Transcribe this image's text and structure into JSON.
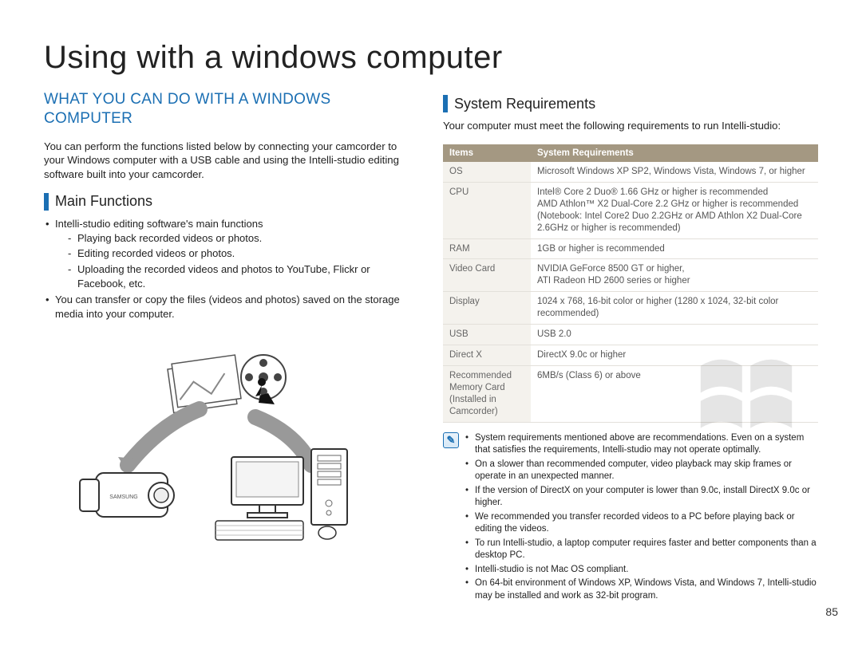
{
  "page": {
    "title": "Using with a windows computer",
    "number": "85"
  },
  "left": {
    "heading": "WHAT YOU CAN DO WITH A WINDOWS COMPUTER",
    "intro": "You can perform the functions listed below by connecting your camcorder to your Windows computer with a USB cable and using the Intelli-studio editing software built into your camcorder.",
    "mainFunctionsLabel": "Main Functions",
    "bullet1": "Intelli-studio editing software's main functions",
    "dash1": "Playing back recorded videos or photos.",
    "dash2": "Editing recorded videos or photos.",
    "dash3": "Uploading the recorded videos and photos to YouTube, Flickr or Facebook, etc.",
    "bullet2": "You can transfer or copy the files (videos and photos) saved on the storage media into your computer."
  },
  "right": {
    "sysReqLabel": "System Requirements",
    "intro": "Your computer must meet the following requirements to run Intelli-studio:",
    "tableHeaders": {
      "items": "Items",
      "req": "System Requirements"
    },
    "rows": [
      {
        "item": "OS",
        "req": "Microsoft Windows XP SP2, Windows Vista, Windows 7, or higher"
      },
      {
        "item": "CPU",
        "req": "Intel® Core 2 Duo® 1.66 GHz or higher is recommended\nAMD Athlon™ X2 Dual-Core 2.2 GHz or higher is recommended\n(Notebook: Intel Core2 Duo 2.2GHz or AMD Athlon X2 Dual-Core 2.6GHz or higher is recommended)"
      },
      {
        "item": "RAM",
        "req": "1GB or higher is recommended"
      },
      {
        "item": "Video Card",
        "req": "NVIDIA GeForce 8500 GT or higher,\nATI Radeon HD 2600 series or higher"
      },
      {
        "item": "Display",
        "req": "1024 x 768, 16-bit color or higher (1280 x 1024, 32-bit color recommended)"
      },
      {
        "item": "USB",
        "req": "USB 2.0"
      },
      {
        "item": "Direct X",
        "req": "DirectX 9.0c or higher"
      },
      {
        "item": "Recommended Memory Card (Installed in Camcorder)",
        "req": "6MB/s (Class 6) or above"
      }
    ],
    "notes": [
      "System requirements mentioned above are recommendations. Even on a system that satisfies the requirements, Intelli-studio may not operate optimally.",
      "On a slower than recommended computer, video playback may skip frames or operate in an unexpected manner.",
      "If the version of DirectX on your computer is lower than 9.0c, install DirectX 9.0c or higher.",
      "We recommended you transfer recorded videos to a PC before playing back or editing the videos.",
      "To run Intelli-studio, a laptop computer requires faster and better components than a desktop PC.",
      "Intelli-studio is not Mac OS compliant.",
      "On 64-bit environment of Windows XP, Windows Vista, and Windows 7, Intelli-studio may be installed and work as 32-bit program."
    ]
  }
}
